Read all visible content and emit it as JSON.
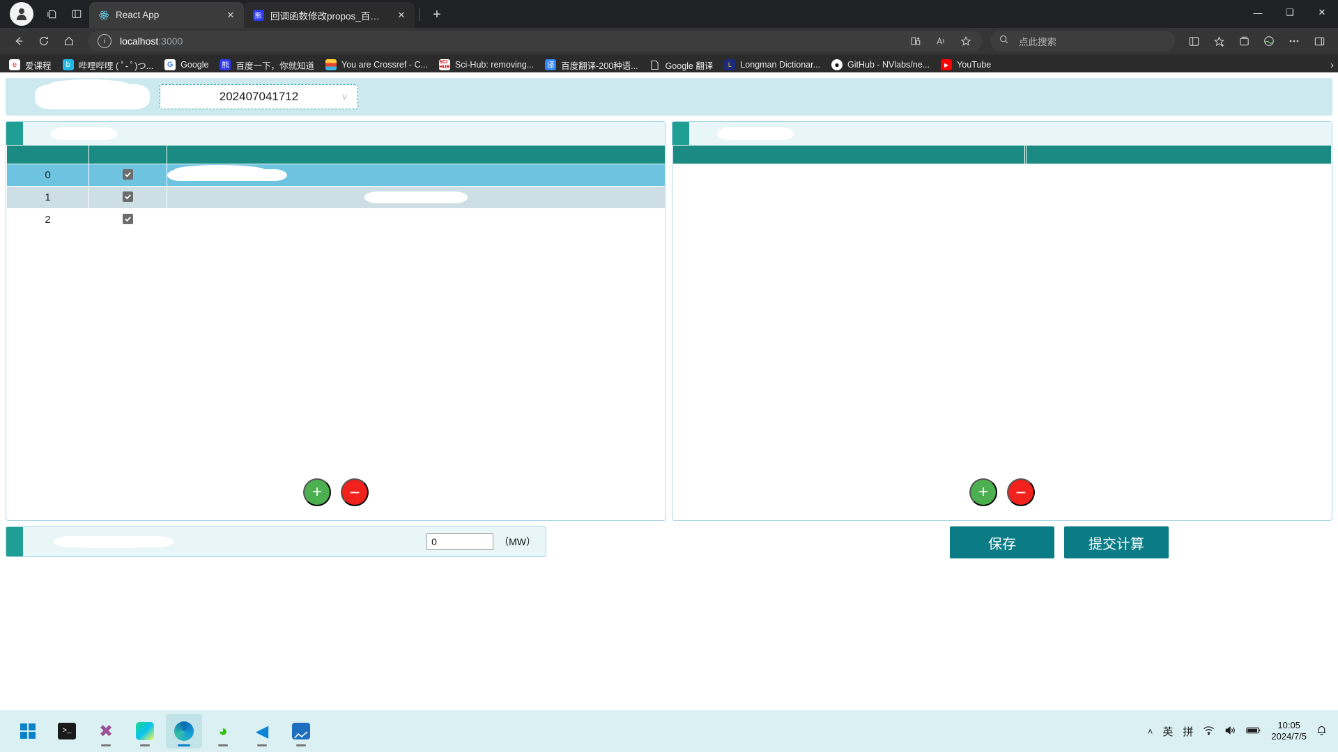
{
  "browser": {
    "tabs": [
      {
        "title": "React App",
        "favicon": "react-icon",
        "active": true,
        "close": "✕"
      },
      {
        "title": "回调函数修改propos_百度搜索",
        "favicon": "baidu-icon",
        "active": false,
        "close": "✕"
      }
    ],
    "newtab_label": "+",
    "window_controls": {
      "minimize": "—",
      "maximize": "❑",
      "close": "✕"
    },
    "toolbar": {
      "back_icon": "back-arrow-icon",
      "reload_icon": "reload-icon",
      "home_icon": "home-icon",
      "url": "localhost",
      "url_suffix": ":3000",
      "info_icon": "i",
      "split_icon": "split-screen-icon",
      "read_aloud_icon": "read-aloud-icon",
      "favorite_icon": "star-icon",
      "collections_icon": "collections-icon",
      "favorites_icon": "favorites-icon",
      "browser_essentials_icon": "browser-essentials-icon",
      "settings_icon": "more-icon",
      "sidebar_icon": "sidebar-icon"
    },
    "search": {
      "placeholder": "点此搜索",
      "icon": "search-icon"
    },
    "bookmarks": [
      {
        "label": "爱课程",
        "icon": "icourse-icon"
      },
      {
        "label": "哔哩哔哩 ( ﾟ- ﾟ)つ...",
        "icon": "bilibili-icon"
      },
      {
        "label": "Google",
        "icon": "google-icon"
      },
      {
        "label": "百度一下，你就知道",
        "icon": "baidu-icon"
      },
      {
        "label": "You are Crossref - C...",
        "icon": "crossref-icon"
      },
      {
        "label": "Sci-Hub: removing...",
        "icon": "scihub-icon"
      },
      {
        "label": "百度翻译-200种语...",
        "icon": "fanyi-icon"
      },
      {
        "label": "Google 翻译",
        "icon": "doc-icon"
      },
      {
        "label": "Longman Dictionar...",
        "icon": "longman-icon"
      },
      {
        "label": "GitHub - NVlabs/ne...",
        "icon": "github-icon"
      },
      {
        "label": "YouTube",
        "icon": "youtube-icon"
      }
    ],
    "bookmarks_overflow": "›"
  },
  "app": {
    "period_select": {
      "value": "202407041712",
      "chevron": "∨"
    },
    "left_panel": {
      "columns": [
        "",
        "",
        ""
      ],
      "rows": [
        {
          "index": "0",
          "checked": true,
          "selected": true
        },
        {
          "index": "1",
          "checked": true,
          "selected": false
        },
        {
          "index": "2",
          "checked": true,
          "selected": false
        }
      ],
      "add_label": "+",
      "remove_label": "−"
    },
    "right_panel": {
      "columns": [
        "",
        "",
        ""
      ],
      "rows": [],
      "add_label": "+",
      "remove_label": "−"
    },
    "bottom": {
      "value": "0",
      "unit": "（MW）",
      "save_label": "保存",
      "submit_label": "提交计算"
    }
  },
  "taskbar": {
    "items": [
      {
        "name": "start-button",
        "icon": "windows-logo"
      },
      {
        "name": "terminal",
        "icon": "terminal-icon"
      },
      {
        "name": "visual-studio",
        "icon": "visual-studio-icon"
      },
      {
        "name": "pycharm",
        "icon": "pycharm-icon"
      },
      {
        "name": "edge",
        "icon": "edge-icon",
        "active": true
      },
      {
        "name": "wechat",
        "icon": "wechat-icon"
      },
      {
        "name": "vscode",
        "icon": "vscode-icon"
      },
      {
        "name": "app-extra",
        "icon": "chart-app-icon"
      }
    ],
    "tray": {
      "chevron": "˄",
      "ime_lang": "英",
      "ime_mode": "拼",
      "wifi_icon": "wifi-icon",
      "volume_icon": "volume-icon",
      "battery_icon": "battery-icon",
      "time": "10:05",
      "date": "2024/7/5",
      "notification_icon": "bell-icon"
    }
  },
  "colors": {
    "teal": "#1a8a82",
    "panel_border": "#a9d6e5",
    "row_selected": "#6ec3e0",
    "button_teal": "#0b7c86",
    "add_green": "#4caf50",
    "del_red": "#f1221d"
  }
}
